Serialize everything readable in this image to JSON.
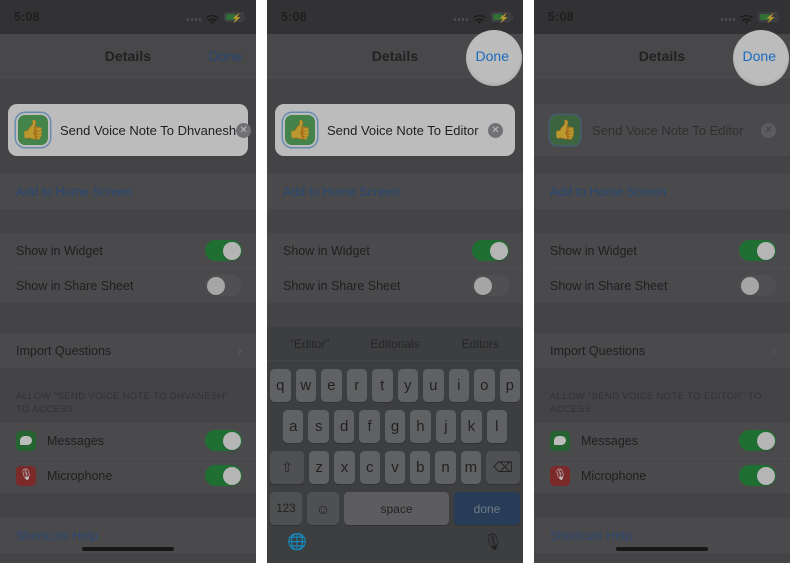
{
  "meta": {
    "panel_count": 3
  },
  "status_bar": {
    "time": "5:08",
    "signal_icon": "signal-dots-icon",
    "wifi_icon": "wifi-icon",
    "battery_icon": "battery-charging-icon"
  },
  "nav": {
    "title": "Details",
    "done_label": "Done"
  },
  "icons": {
    "thumb_glyph": "👍",
    "clear_glyph": "✕",
    "chevron_glyph": "›",
    "mic_glyph": "🎙",
    "globe_glyph": "🌐",
    "emoji_glyph": "☺",
    "shift_glyph": "⇧",
    "backspace_glyph": "⌫"
  },
  "colors": {
    "accent_blue": "#0a84ff",
    "link_blue": "#1c4e8f",
    "toggle_on_green": "#128a2c",
    "shortcut_green": "#4aa94f",
    "messages_green": "#1a7a2b",
    "microphone_red": "#9e2020",
    "done_key_blue": "#1e3d63",
    "panel_bg": "#4a4a4c",
    "row_bg": "#525254"
  },
  "panels": [
    {
      "id": "panel-1",
      "shortcut_name": "Send Voice Note To Dhvanesh",
      "field_state": "editing",
      "icon_selected": true,
      "done_highlighted": false,
      "keyboard_visible": false,
      "add_to_home_screen": "Add to Home Screen",
      "toggles": [
        {
          "label": "Show in Widget",
          "on": true
        },
        {
          "label": "Show in Share Sheet",
          "on": false
        }
      ],
      "import_questions": "Import Questions",
      "permissions_caption": "ALLOW “SEND VOICE NOTE TO DHVANESH” TO ACCESS",
      "permissions": [
        {
          "label": "Messages",
          "icon": "messages-icon",
          "on": true
        },
        {
          "label": "Microphone",
          "icon": "microphone-icon",
          "on": true
        }
      ],
      "help_link": "Shortcuts Help"
    },
    {
      "id": "panel-2",
      "shortcut_name": "Send Voice Note To Editor",
      "field_state": "editing",
      "icon_selected": true,
      "done_highlighted": true,
      "keyboard_visible": true,
      "add_to_home_screen": "Add to Home Screen",
      "toggles": [
        {
          "label": "Show in Widget",
          "on": true
        },
        {
          "label": "Show in Share Sheet",
          "on": false
        }
      ],
      "import_questions": "Import Questions",
      "keyboard": {
        "suggestions": [
          "“Editor”",
          "Editorials",
          "Editors"
        ],
        "row1": [
          "q",
          "w",
          "e",
          "r",
          "t",
          "y",
          "u",
          "i",
          "o",
          "p"
        ],
        "row2": [
          "a",
          "s",
          "d",
          "f",
          "g",
          "h",
          "j",
          "k",
          "l"
        ],
        "row3": [
          "z",
          "x",
          "c",
          "v",
          "b",
          "n",
          "m"
        ],
        "number_key": "123",
        "space_key": "space",
        "return_key": "done"
      }
    },
    {
      "id": "panel-3",
      "shortcut_name": "Send Voice Note To Editor",
      "field_state": "inactive",
      "icon_selected": false,
      "done_highlighted": true,
      "keyboard_visible": false,
      "add_to_home_screen": "Add to Home Screen",
      "toggles": [
        {
          "label": "Show in Widget",
          "on": true
        },
        {
          "label": "Show in Share Sheet",
          "on": false
        }
      ],
      "import_questions": "Import Questions",
      "permissions_caption": "ALLOW “SEND VOICE NOTE TO EDITOR” TO ACCESS",
      "permissions": [
        {
          "label": "Messages",
          "icon": "messages-icon",
          "on": true
        },
        {
          "label": "Microphone",
          "icon": "microphone-icon",
          "on": true
        }
      ],
      "help_link": "Shortcuts Help"
    }
  ]
}
